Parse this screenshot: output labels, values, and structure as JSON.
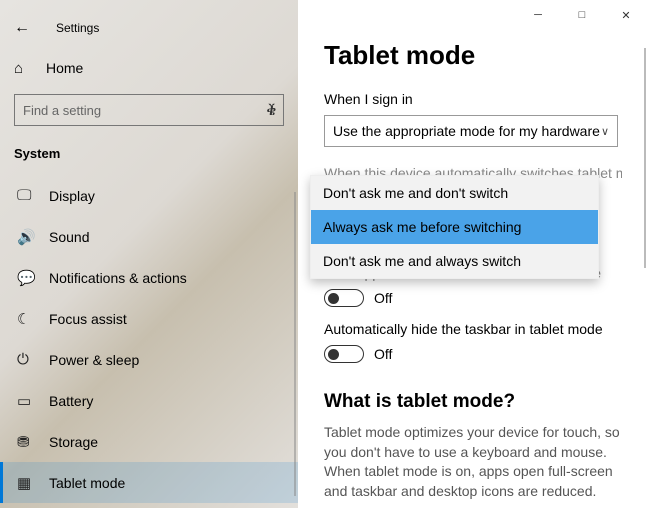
{
  "header": {
    "app_title": "Settings",
    "home_label": "Home"
  },
  "search": {
    "placeholder": "Find a setting"
  },
  "sys_label": "System",
  "nav": [
    {
      "label": "Display"
    },
    {
      "label": "Sound"
    },
    {
      "label": "Notifications & actions"
    },
    {
      "label": "Focus assist"
    },
    {
      "label": "Power & sleep"
    },
    {
      "label": "Battery"
    },
    {
      "label": "Storage"
    },
    {
      "label": "Tablet mode"
    }
  ],
  "page": {
    "title": "Tablet mode",
    "signin_label": "When I sign in",
    "signin_value": "Use the appropriate mode for my hardware",
    "switch_label_partial": "When this device automatically switches tablet mode on or",
    "hide_icons_label": "Hide app icons on the taskbar in tablet mode",
    "hide_icons_state": "Off",
    "hide_taskbar_label": "Automatically hide the taskbar in tablet mode",
    "hide_taskbar_state": "Off",
    "what_header": "What is tablet mode?",
    "what_body": "Tablet mode optimizes your device for touch, so you don't have to use a keyboard and mouse. When tablet mode is on, apps open full-screen and taskbar and desktop icons are reduced."
  },
  "dropdown": {
    "options": [
      "Don't ask me and don't switch",
      "Always ask me before switching",
      "Don't ask me and always switch"
    ],
    "selected_index": 1
  }
}
